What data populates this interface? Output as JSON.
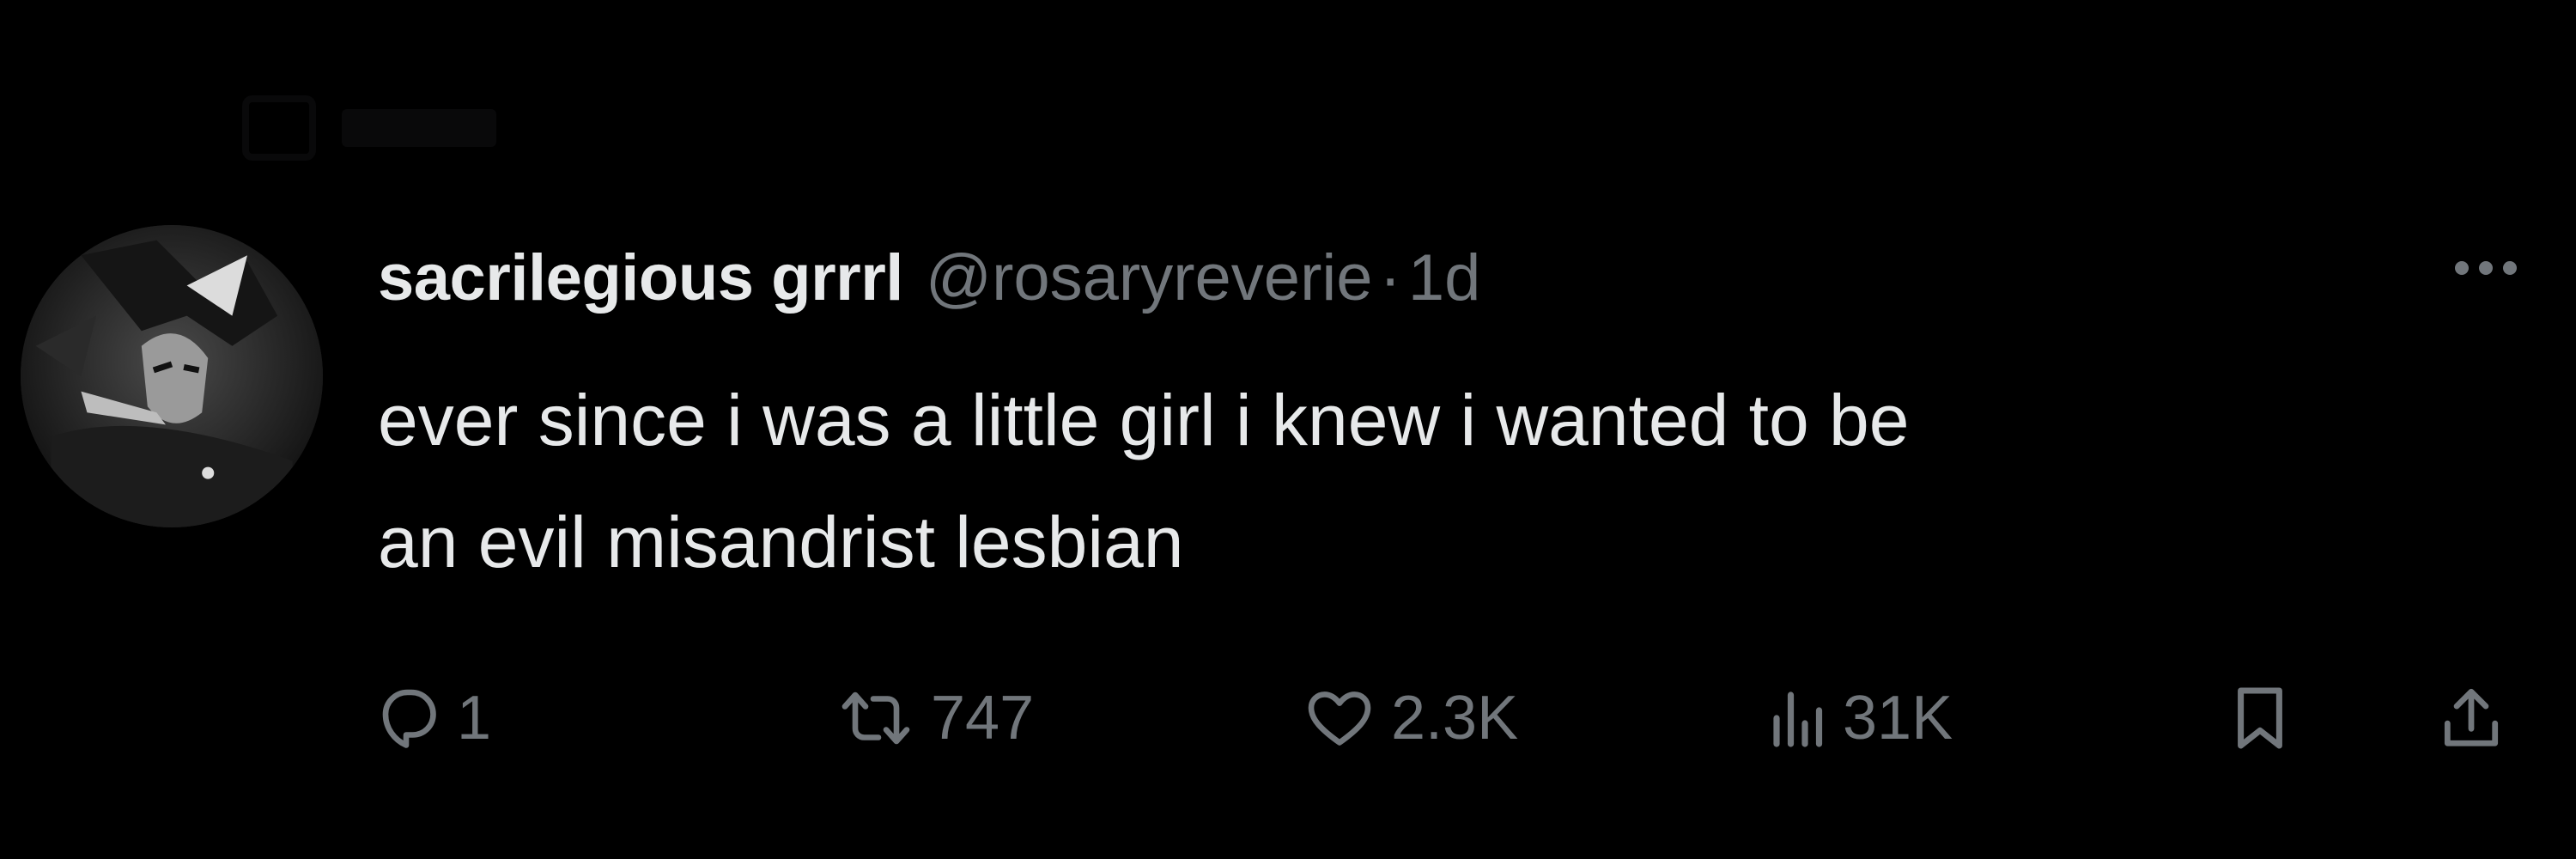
{
  "tweet": {
    "display_name": "sacrilegious grrrl",
    "handle": "@rosaryreverie",
    "separator": "·",
    "timestamp": "1d",
    "text_lines": [
      "ever since i was a little girl i knew i wanted to be",
      "an evil misandrist lesbian"
    ],
    "actions": {
      "replies": "1",
      "reposts": "747",
      "likes": "2.3K",
      "views": "31K"
    }
  },
  "icons": {
    "reply": "speech-bubble-icon",
    "repost": "repost-arrows-icon",
    "like": "heart-icon",
    "views": "bar-chart-icon",
    "bookmark": "bookmark-icon",
    "share": "share-upload-icon",
    "more": "more-dots-icon"
  },
  "colors": {
    "background": "#000000",
    "primary_text": "#e7e9ea",
    "secondary_text": "#71767b"
  }
}
